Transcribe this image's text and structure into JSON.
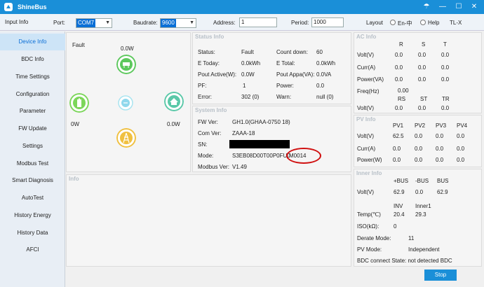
{
  "app": {
    "title": "ShineBus"
  },
  "toolbar": {
    "input_info": "Input Info",
    "port_label": "Port:",
    "port_value": "COM7",
    "baud_label": "Baudrate:",
    "baud_value": "9600",
    "address_label": "Address:",
    "address_value": "1",
    "period_label": "Period:",
    "period_value": "1000",
    "layout": "Layout",
    "lang": "En-中",
    "help": "Help",
    "model": "TL-X"
  },
  "sidebar": {
    "items": [
      "Device Info",
      "BDC Info",
      "Time Settings",
      "Configuration",
      "Parameter",
      "FW Update",
      "Settings",
      "Modbus Test",
      "Smart Diagnosis",
      "AutoTest",
      "History Energy",
      "History Data",
      "AFCI"
    ]
  },
  "device": {
    "fault": "Fault",
    "pv_power": "0.0W",
    "batt_power": "0W",
    "home_power": "0.0W"
  },
  "status": {
    "header": "Status Info",
    "status_l": "Status:",
    "status_v": "Fault",
    "countdown_l": "Count down:",
    "countdown_v": "60",
    "etoday_l": "E Today:",
    "etoday_v": "0.0kWh",
    "etotal_l": "E Total:",
    "etotal_v": "0.0kWh",
    "pout_l": "Pout Active(W):",
    "pout_v": "0.0W",
    "pappa_l": "Pout Appa(VA):",
    "pappa_v": "0.0VA",
    "pf_l": "PF:",
    "pf_v": "1",
    "power_l": "Power:",
    "power_v": "0.0",
    "error_l": "Error:",
    "error_v": "302 (0)",
    "warn_l": "Warn:",
    "warn_v": "null (0)"
  },
  "system": {
    "header": "System Info",
    "fw_l": "FW Ver:",
    "fw_v": "GH1.0(GHAA-0750  18)",
    "com_l": "Com Ver:",
    "com_v": "ZAAA-18",
    "sn_l": "SN:",
    "mode_l": "Mode:",
    "mode_v": "S3EB08D00T00P0FU0",
    "mode_v2": "M0014",
    "modbus_l": "Modbus Ver:",
    "modbus_v": "V1.49"
  },
  "info": {
    "header": "Info"
  },
  "ac": {
    "header": "AC Info",
    "cols": [
      "R",
      "S",
      "T"
    ],
    "volt_l": "Volt(V)",
    "volt": [
      "0.0",
      "0.0",
      "0.0"
    ],
    "curr_l": "Curr(A)",
    "curr": [
      "0.0",
      "0.0",
      "0.0"
    ],
    "power_l": "Power(VA)",
    "power": [
      "0.0",
      "0.0",
      "0.0"
    ],
    "freq_l": "Freq(Hz)",
    "freq_v": "0.00",
    "cols2": [
      "RS",
      "ST",
      "TR"
    ],
    "volt2_l": "Volt(V)",
    "volt2": [
      "0.0",
      "0.0",
      "0.0"
    ]
  },
  "pv": {
    "header": "PV Info",
    "cols": [
      "PV1",
      "PV2",
      "PV3",
      "PV4"
    ],
    "volt_l": "Volt(V)",
    "volt": [
      "62.5",
      "0.0",
      "0.0",
      "0.0"
    ],
    "curr_l": "Curr(A)",
    "curr": [
      "0.0",
      "0.0",
      "0.0",
      "0.0"
    ],
    "power_l": "Power(W)",
    "power": [
      "0.0",
      "0.0",
      "0.0",
      "0.0"
    ]
  },
  "inner": {
    "header": "Inner Info",
    "cols": [
      "+BUS",
      "-BUS",
      "BUS"
    ],
    "volt_l": "Volt(V)",
    "volt": [
      "62.9",
      "0.0",
      "62.9"
    ],
    "cols2": [
      "INV",
      "Inner1"
    ],
    "temp_l": "Temp(℃)",
    "temp": [
      "20.4",
      "29.3"
    ],
    "iso_l": "ISO(kΩ):",
    "iso_v": "0",
    "derate_l": "Derate Mode:",
    "derate_v": "11",
    "pvmode_l": "PV Mode:",
    "pvmode_v": "Independent",
    "bdc_l": "BDC connect State: not detected BDC"
  },
  "actions": {
    "stop": "Stop"
  }
}
